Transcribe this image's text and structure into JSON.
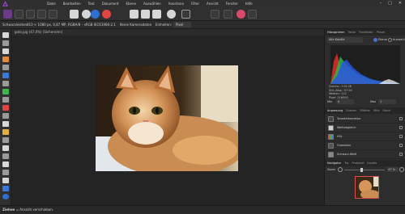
{
  "menubar": {
    "items": [
      "Datei",
      "Bearbeiten",
      "Text",
      "Dokument",
      "Ebene",
      "Auswählen",
      "Anordnen",
      "Filter",
      "Ansicht",
      "Fenster",
      "Hilfe"
    ],
    "window_buttons": {
      "minimize": "–",
      "maximize": "□",
      "close": "✕"
    }
  },
  "context_bar": {
    "prefix": "Schwarzleisten",
    "doc_info": "810 × 1080 px, 0,87 MP, RGBA/8 – sRGB IEC61966-2.1",
    "no_camera": "Keine Kameradaten",
    "units_label": "Einheiten:",
    "units_value": "Pixel"
  },
  "document": {
    "tab_title": "gato.jpg (47,0%) (Sichern/en)"
  },
  "panels": {
    "histogram": {
      "tabs": [
        "Histogramm",
        "Farbe",
        "Farbfelder",
        "Pinsel"
      ],
      "channel_select": "Alle Kanäle",
      "toggle_marked": "Ebene",
      "toggle_other": "Auswahl",
      "stats": [
        "Durchs.: 115,28",
        "Std.-Abw.: 57,04",
        "Median: 112",
        "Pixel: 216000"
      ],
      "min_label": "Min",
      "min_value": "0",
      "max_label": "Max",
      "max_value": "1"
    },
    "adjustments": {
      "tabs": [
        "Anpassung",
        "Ebenen",
        "Effekte",
        "Stile",
        "Stock"
      ],
      "items": [
        "Tonwertkorrektur",
        "Weißabgleich",
        "HSL",
        "Gradation",
        "Schwarz-Weiß"
      ]
    },
    "navigator": {
      "tabs": [
        "Navigator",
        "Tra",
        "Protokoll",
        "Kanäle"
      ],
      "zoom_label": "Zoom",
      "zoom_value": "47 %"
    }
  },
  "status": {
    "hint_bold": "Ziehen",
    "hint_rest": "= Ansicht verschieben."
  },
  "colors": {
    "accent": "#9b4dbf",
    "histo_red": "#e0302a",
    "histo_green": "#2fb545",
    "histo_blue": "#2a55e0"
  },
  "icons": [
    "affinity-logo-icon",
    "persona-photo-icon",
    "liquify-icon",
    "develop-icon",
    "tone-map-icon",
    "export-icon",
    "move-icon",
    "crop-icon",
    "brush-icon",
    "eraser-icon",
    "fill-icon",
    "selection-icon",
    "zoom-icon",
    "hand-icon"
  ]
}
